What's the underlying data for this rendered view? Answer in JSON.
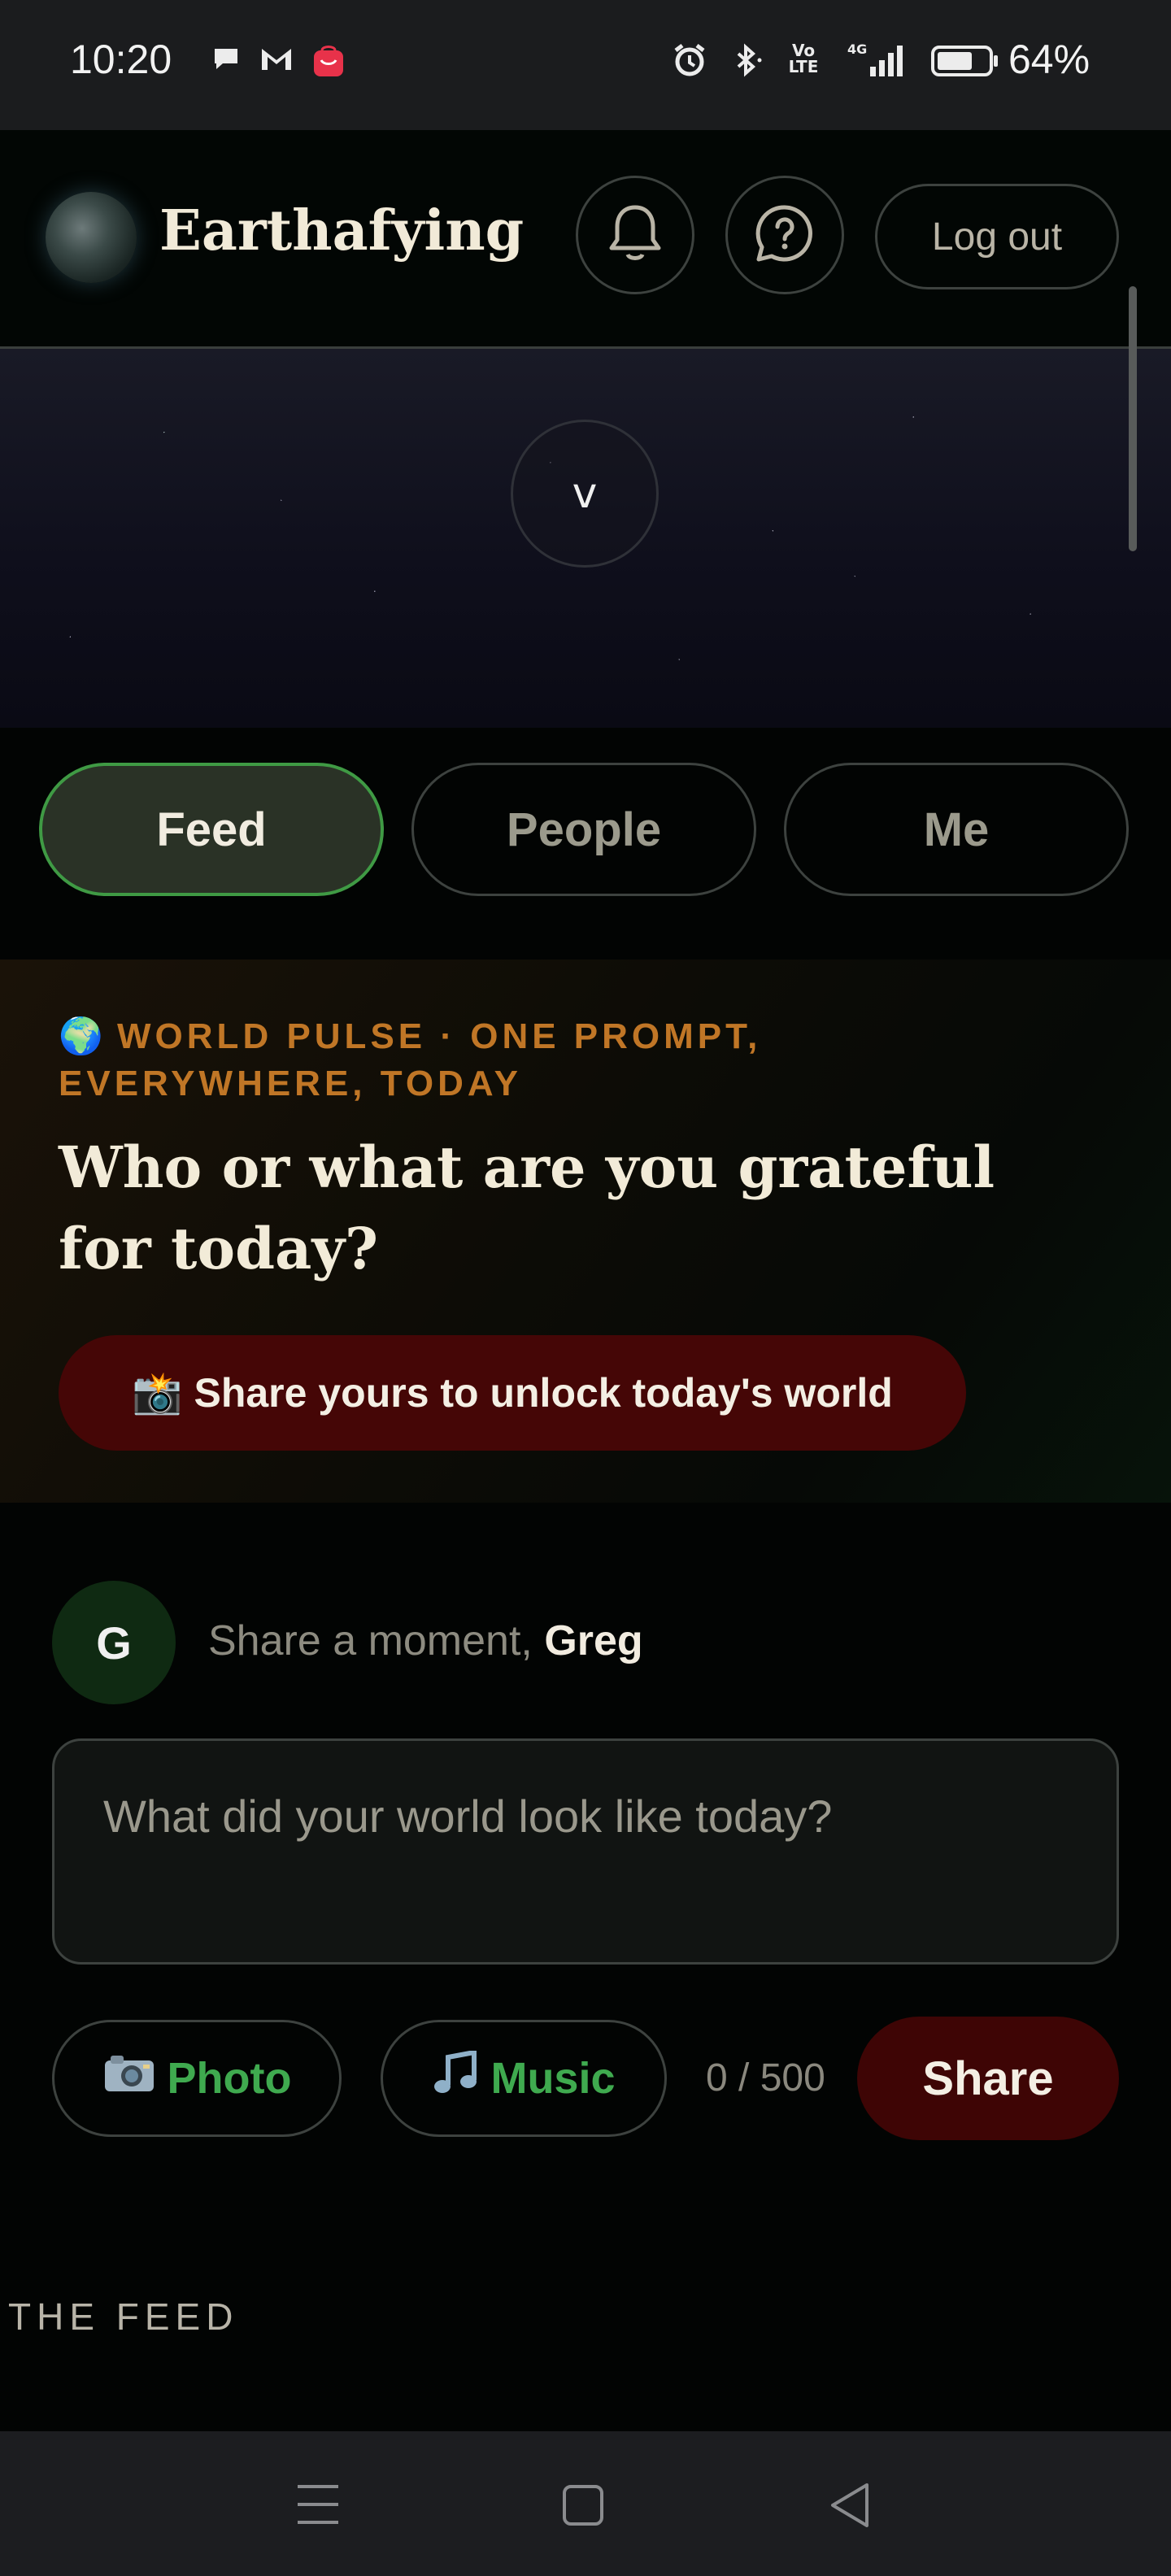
{
  "status_bar": {
    "time": "10:20",
    "notification_icons": [
      "chat-bubble-icon",
      "gmail-icon",
      "shopping-bag-icon"
    ],
    "system_icons": [
      "alarm-icon",
      "bluetooth-icon",
      "volte-icon",
      "signal-4g-icon",
      "battery-icon"
    ],
    "battery": "64%"
  },
  "header": {
    "brand": "Earthafying",
    "logout_label": "Log out"
  },
  "banner": {
    "chevron": "v"
  },
  "tabs": [
    {
      "label": "Feed",
      "active": true
    },
    {
      "label": "People",
      "active": false
    },
    {
      "label": "Me",
      "active": false
    }
  ],
  "world_pulse": {
    "emoji": "🌍",
    "label": "WORLD PULSE · ONE PROMPT, EVERYWHERE, TODAY",
    "question": "Who or what are you grateful for today?",
    "cta_emoji": "📸",
    "cta_label": "Share yours to unlock today's world"
  },
  "composer": {
    "avatar_initial": "G",
    "prompt_prefix": "Share a moment,",
    "user_name": "Greg",
    "placeholder": "What did your world look like today?",
    "photo_label": "Photo",
    "music_label": "Music",
    "counter": "0 / 500",
    "share_label": "Share"
  },
  "feed": {
    "heading": "THE FEED"
  },
  "colors": {
    "accent_green": "#3f9a44",
    "accent_red": "#450606",
    "pulse_orange": "#c07626",
    "text_cream": "#f1ead8"
  }
}
